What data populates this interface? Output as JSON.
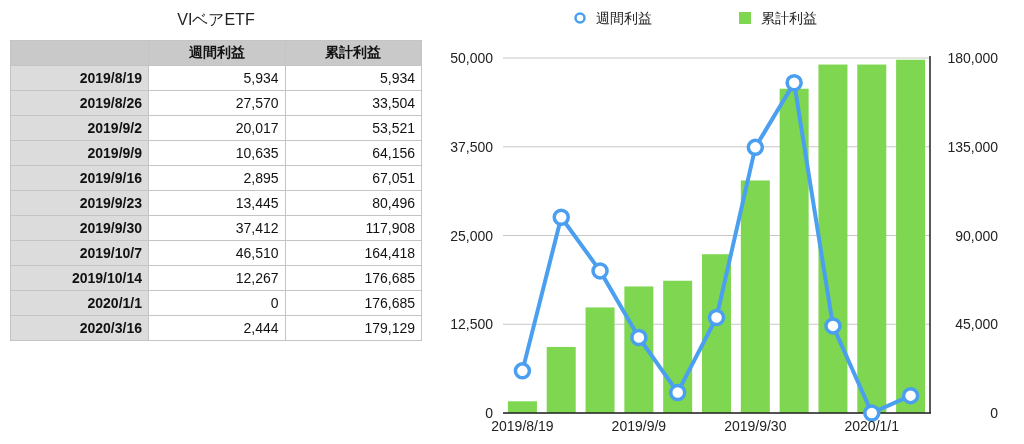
{
  "table": {
    "title": "VIベアETF",
    "columns": [
      "週間利益",
      "累計利益"
    ],
    "rows": [
      {
        "date": "2019/8/19",
        "weekly": "5,934",
        "cumulative": "5,934"
      },
      {
        "date": "2019/8/26",
        "weekly": "27,570",
        "cumulative": "33,504"
      },
      {
        "date": "2019/9/2",
        "weekly": "20,017",
        "cumulative": "53,521"
      },
      {
        "date": "2019/9/9",
        "weekly": "10,635",
        "cumulative": "64,156"
      },
      {
        "date": "2019/9/16",
        "weekly": "2,895",
        "cumulative": "67,051"
      },
      {
        "date": "2019/9/23",
        "weekly": "13,445",
        "cumulative": "80,496"
      },
      {
        "date": "2019/9/30",
        "weekly": "37,412",
        "cumulative": "117,908"
      },
      {
        "date": "2019/10/7",
        "weekly": "46,510",
        "cumulative": "164,418"
      },
      {
        "date": "2019/10/14",
        "weekly": "12,267",
        "cumulative": "176,685"
      },
      {
        "date": "2020/1/1",
        "weekly": "0",
        "cumulative": "176,685"
      },
      {
        "date": "2020/3/16",
        "weekly": "2,444",
        "cumulative": "179,129"
      }
    ]
  },
  "chart": {
    "chart_data": {
      "type": "bar",
      "categories": [
        "2019/8/19",
        null,
        null,
        "2019/9/9",
        null,
        null,
        "2019/9/30",
        null,
        null,
        "2020/1/1",
        null
      ],
      "series": [
        {
          "name": "週間利益",
          "type": "line",
          "marker": "circle",
          "color": "#4a9ff0",
          "values": [
            5934,
            27570,
            20017,
            10635,
            2895,
            13445,
            37412,
            46510,
            12267,
            0,
            2444
          ]
        },
        {
          "name": "累計利益",
          "type": "bar",
          "axis": "y2",
          "color": "#7ed651",
          "values": [
            5934,
            33504,
            53521,
            64156,
            67051,
            80496,
            117908,
            164418,
            176685,
            176685,
            179129
          ]
        }
      ],
      "grid": true,
      "legend": "top",
      "ylim": [
        0,
        50000
      ],
      "yticks": [
        {
          "value": 0,
          "label": "0"
        },
        {
          "value": 12500,
          "label": "12,500"
        },
        {
          "value": 25000,
          "label": "25,000"
        },
        {
          "value": 37500,
          "label": "37,500"
        },
        {
          "value": 50000,
          "label": "50,000"
        }
      ],
      "y2lim": [
        0,
        180000
      ],
      "y2ticks": [
        {
          "value": 0,
          "label": "0"
        },
        {
          "value": 45000,
          "label": "45,000"
        },
        {
          "value": 90000,
          "label": "90,000"
        },
        {
          "value": 135000,
          "label": "135,000"
        },
        {
          "value": 180000,
          "label": "180,000"
        }
      ]
    }
  }
}
